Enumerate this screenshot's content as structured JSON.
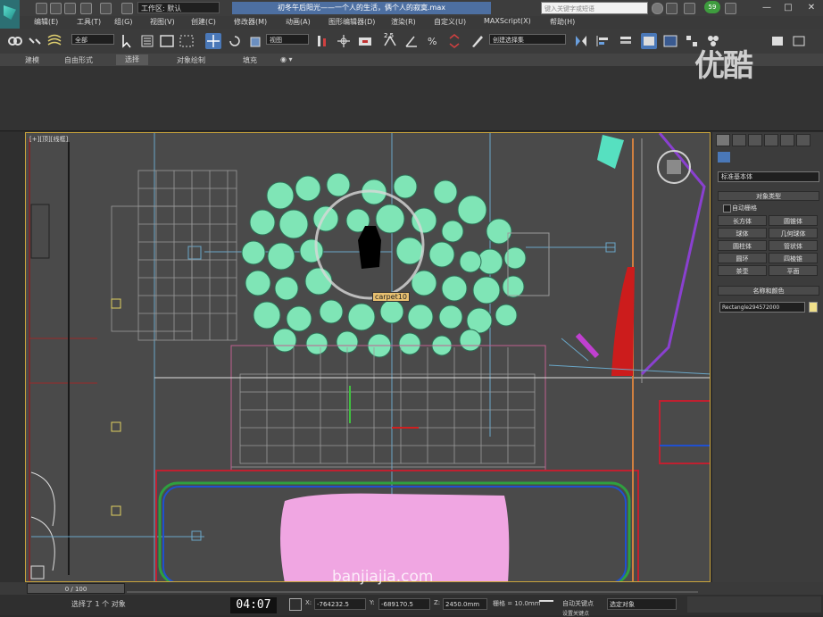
{
  "titlebar": {
    "workspace": "工作区: 默认",
    "title": "初冬午后阳光——一个人的生活，俩个人的寂寞.max",
    "search_placeholder": "键入关键字或短语",
    "user_badge": "59",
    "minimize": "—",
    "maximize": "□",
    "close": "✕"
  },
  "menu": [
    "编辑(E)",
    "工具(T)",
    "组(G)",
    "视图(V)",
    "创建(C)",
    "修改器(M)",
    "动画(A)",
    "图形编辑器(D)",
    "渲染(R)",
    "自定义(U)",
    "MAXScript(X)",
    "帮助(H)"
  ],
  "toolbar": {
    "selection_filter": "全部",
    "reference_coord": "视图",
    "named_selection": "创建选择集",
    "angle_snap_label": "2.5",
    "percent_snap_label": "%"
  },
  "ribbon_tabs": [
    "建模",
    "自由形式",
    "选择",
    "对象绘制",
    "填充"
  ],
  "ribbon_active": "选择",
  "viewport": {
    "label": "[+][顶][线框]",
    "object_label": "carpet10"
  },
  "command_panel": {
    "dropdown": "标准基本体",
    "object_type_title": "对象类型",
    "autogrid": "自动栅格",
    "buttons": [
      "长方体",
      "圆锥体",
      "球体",
      "几何球体",
      "圆柱体",
      "管状体",
      "圆环",
      "四棱锥",
      "茶壶",
      "平面"
    ],
    "name_color_title": "名称和颜色",
    "object_name": "Rectangle294572000",
    "swatch_color": "#f0e08a"
  },
  "timeline": {
    "slider": "0 / 100"
  },
  "status": {
    "selected": "选择了 1 个 对象",
    "video_time": "04:07",
    "x_label": "X:",
    "x_value": "-764232.5",
    "y_label": "Y:",
    "y_value": "-689170.5",
    "z_label": "Z:",
    "z_value": "2450.0mm",
    "grid_label": "栅格 = 10.0mm",
    "auto_key": "自动关键点",
    "selected_object": "选定对象",
    "set_key": "设置关键点"
  },
  "watermark": "优酷",
  "site_watermark": "banjiajia.com"
}
